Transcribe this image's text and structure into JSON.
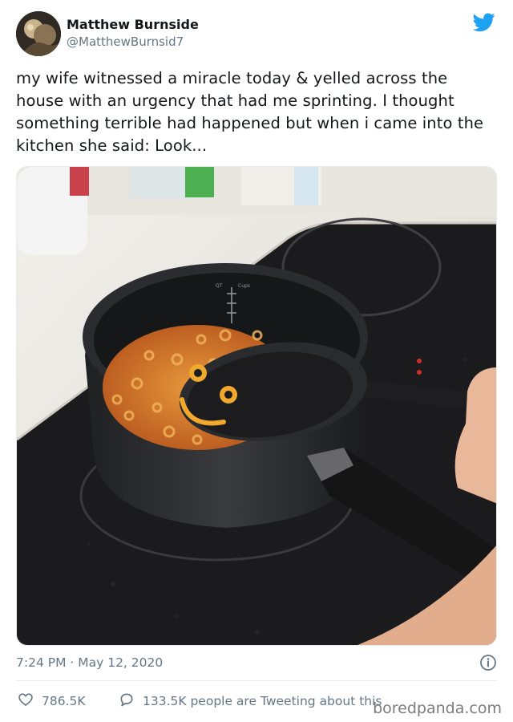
{
  "author": {
    "display_name": "Matthew Burnside",
    "handle": "@MatthewBurnsid7"
  },
  "icons": {
    "brand": "twitter-bird-icon",
    "info": "info-icon",
    "like": "heart-icon",
    "reply": "speech-bubble-icon"
  },
  "tweet": {
    "text": "my wife witnessed a miracle today & yelled across the house with an urgency that had me sprinting. I thought something terrible had happened but when i came into the kitchen she said: Look...",
    "timestamp": "7:24 PM · May 12, 2020"
  },
  "stats": {
    "likes": "786.5K",
    "tweeting": "133.5K people are Tweeting about this"
  },
  "photo": {
    "pot_markings": {
      "qt_label": "QT",
      "cups_label": "Cups"
    }
  },
  "watermark": "boredpanda.com",
  "colors": {
    "twitter_blue": "#1da1f2",
    "secondary_text": "#657786"
  }
}
